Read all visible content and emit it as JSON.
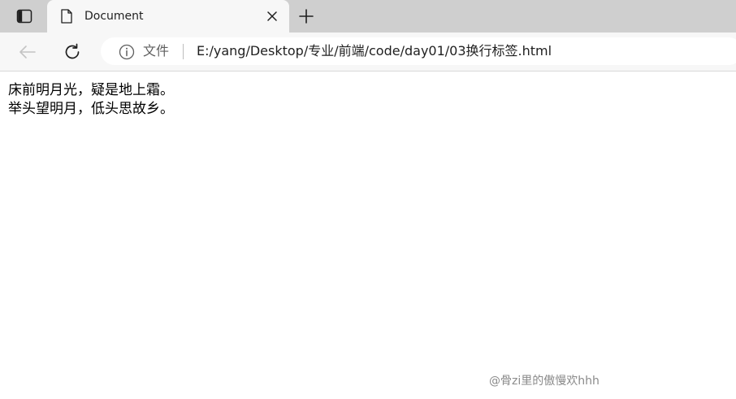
{
  "browser": {
    "tab": {
      "title": "Document",
      "icon": "document-icon"
    },
    "toolbar": {
      "back_icon": "back-arrow-icon",
      "reload_icon": "reload-icon"
    },
    "address": {
      "security_icon": "info-icon",
      "scheme_label": "文件",
      "url": "E:/yang/Desktop/专业/前端/code/day01/03换行标签.html"
    }
  },
  "page": {
    "lines": [
      "床前明月光，疑是地上霜。",
      "举头望明月，低头思故乡。"
    ]
  },
  "watermark": "@骨zi里的傲慢欢hhh"
}
